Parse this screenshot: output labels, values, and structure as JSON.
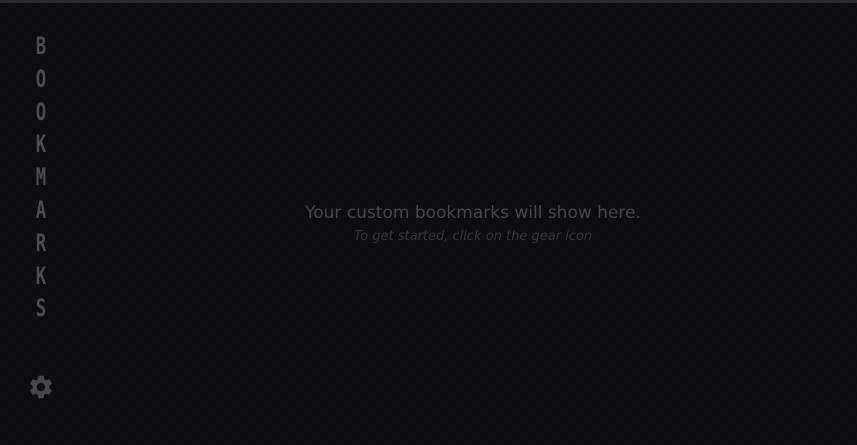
{
  "sidebar": {
    "title_letters": [
      "B",
      "O",
      "O",
      "K",
      "M",
      "A",
      "R",
      "K",
      "S"
    ],
    "settings_icon": "gear-icon"
  },
  "main": {
    "empty_title": "Your custom bookmarks will show here.",
    "empty_subtitle": "To get started, click on the gear icon"
  },
  "colors": {
    "background": "#0b0b0d",
    "title_text": "#4b4c52",
    "gear": "#46474c",
    "message_text": "#46464e",
    "hint_text": "#36363c"
  }
}
